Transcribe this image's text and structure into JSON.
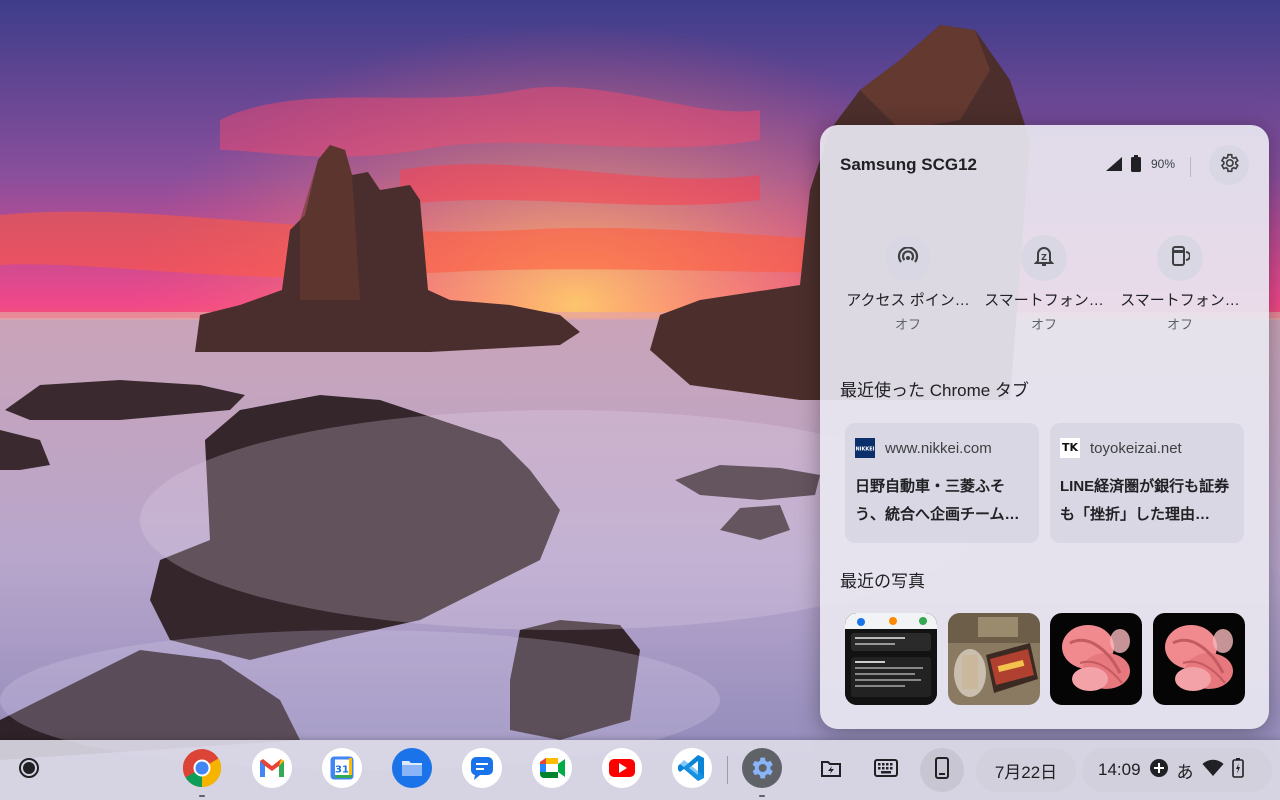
{
  "wallpaper": {
    "icon": "sea-stack-sunset-photo"
  },
  "phone_hub": {
    "device_name": "Samsung SCG12",
    "battery_percent": "90%",
    "icons": [
      "signal-icon",
      "battery-icon",
      "gear-icon"
    ],
    "features": [
      {
        "label": "アクセス ポイン…",
        "state": "オフ",
        "icon": "hotspot-icon"
      },
      {
        "label": "スマートフォン…",
        "state": "オフ",
        "icon": "silence-phone-icon"
      },
      {
        "label": "スマートフォン…",
        "state": "オフ",
        "icon": "locate-phone-icon"
      }
    ],
    "recent_tabs_title": "最近使った Chrome タブ",
    "recent_tabs": [
      {
        "site": "www.nikkei.com",
        "favicon_text": "NIKKEI",
        "title": "日野自動車・三菱ふそう、統合へ企画チーム…"
      },
      {
        "site": "toyokeizai.net",
        "favicon_text": "TK",
        "title": "LINE経済圏が銀行も証券も「挫折」した理由…"
      }
    ],
    "recent_photos_title": "最近の写真",
    "recent_photos": [
      "screenshot-thumbnail",
      "cafe-table-photo",
      "flower-photo",
      "flower-photo"
    ]
  },
  "shelf": {
    "apps": [
      {
        "name": "chrome",
        "icon": "chrome-icon",
        "running": true
      },
      {
        "name": "gmail",
        "icon": "gmail-icon"
      },
      {
        "name": "calendar",
        "icon": "calendar-icon",
        "label": "31"
      },
      {
        "name": "files",
        "icon": "folder-icon"
      },
      {
        "name": "messages",
        "icon": "messages-icon"
      },
      {
        "name": "meet",
        "icon": "meet-icon"
      },
      {
        "name": "youtube",
        "icon": "youtube-icon"
      },
      {
        "name": "vscode",
        "icon": "vscode-icon"
      },
      {
        "name": "settings",
        "icon": "gear-icon",
        "running": true
      }
    ],
    "tray": {
      "date": "7月22日",
      "time": "14:09",
      "ime": "あ",
      "icons": [
        "holding-space-icon",
        "keyboard-icon",
        "phone-icon",
        "add-circle-icon",
        "wifi-icon",
        "battery-icon"
      ]
    },
    "colors": {
      "accent": "#1a73e8",
      "gmail_red": "#ea4335",
      "youtube_red": "#ff0000",
      "vscode_blue": "#0a84d6"
    }
  }
}
